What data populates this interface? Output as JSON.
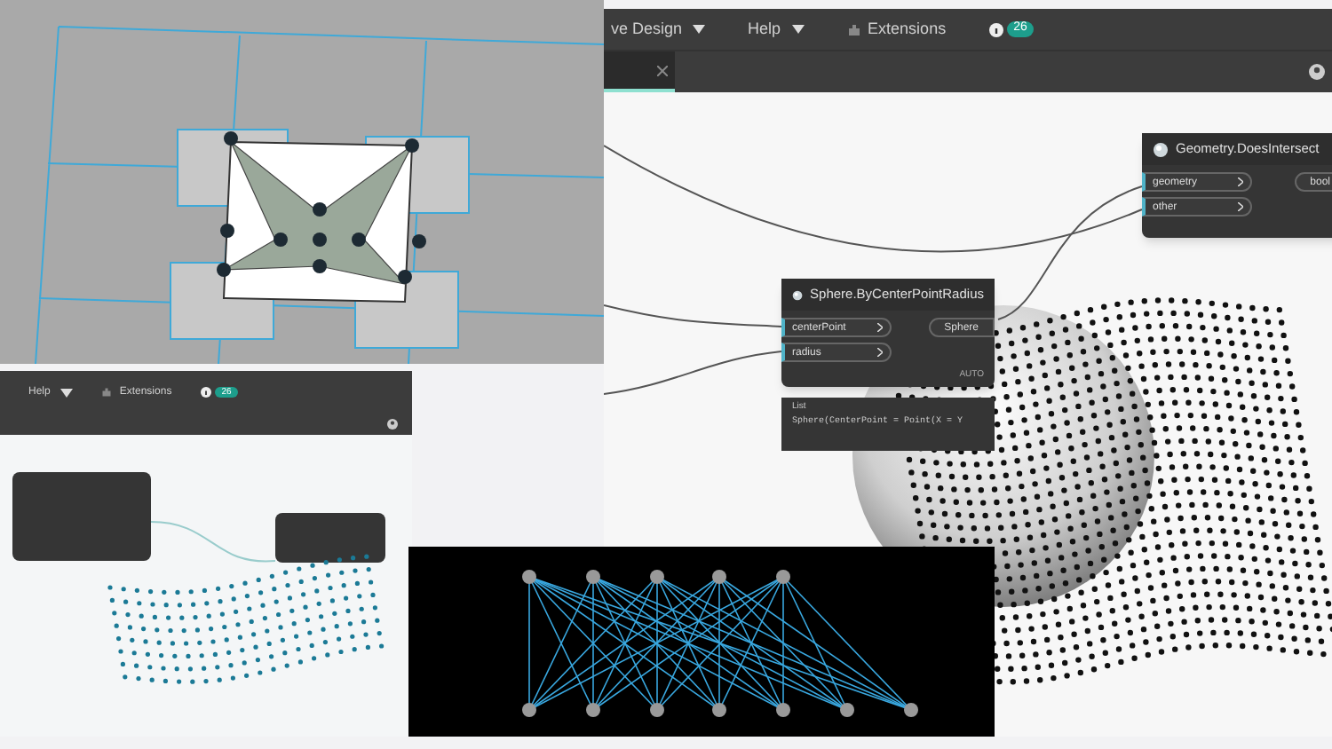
{
  "main_window": {
    "menu": [
      {
        "label": "ve Design"
      },
      {
        "label": "Help"
      }
    ],
    "extensions": "Extensions",
    "notification_count": "26",
    "nodes": [
      {
        "title": "Geometry.DoesIntersect",
        "inputs": [
          "geometry",
          "other"
        ],
        "outputs": [
          "bool"
        ]
      },
      {
        "title": "Sphere.ByCenterPointRadius",
        "inputs": [
          "centerPoint",
          "radius"
        ],
        "outputs": [
          "Sphere"
        ],
        "lacing": "AUTO"
      }
    ],
    "preview": {
      "header": "List",
      "item": "Sphere(CenterPoint = Point(X = Y"
    }
  },
  "small_window": {
    "menu": [
      {
        "label": "Help"
      }
    ],
    "extensions": "Extensions",
    "notification_count": "26"
  }
}
